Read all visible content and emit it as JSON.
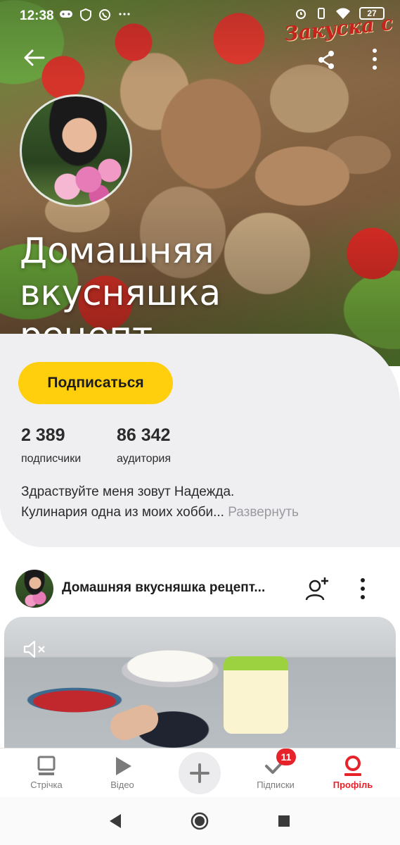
{
  "status_bar": {
    "time": "12:38",
    "battery": "27",
    "left_icons": [
      "gamepad-icon",
      "shield-icon",
      "viber-icon",
      "more-dots-icon"
    ],
    "right_icons": [
      "alarm-icon",
      "vibrate-icon",
      "wifi-icon",
      "battery-icon"
    ]
  },
  "header": {
    "back_icon": "arrow-left-icon",
    "share_icon": "share-icon",
    "more_icon": "kebab-menu-icon",
    "banner_watermark": "Закуска с"
  },
  "channel": {
    "title": "Домашняя вкусняшка рецепт...",
    "subscribe_label": "Подписаться",
    "subscribers_count": "2 389",
    "subscribers_label": "подписчики",
    "audience_count": "86 342",
    "audience_label": "аудитория",
    "about_line1": "Здраствуйте меня зовут Надежда.",
    "about_line2": "Кулинария одна  из моих хобби...",
    "about_expand": "Развернуть"
  },
  "post": {
    "author": "Домашняя вкусняшка рецепт...",
    "follow_icon": "add-user-icon",
    "more_icon": "kebab-menu-icon",
    "mute_icon": "speaker-muted-icon"
  },
  "bottom_nav": {
    "items": [
      {
        "label": "Стрічка",
        "icon": "feed-icon"
      },
      {
        "label": "Відео",
        "icon": "play-icon"
      },
      {
        "label": "",
        "icon": "plus-icon"
      },
      {
        "label": "Підписки",
        "icon": "check-icon",
        "badge": "11"
      },
      {
        "label": "Профіль",
        "icon": "profile-icon"
      }
    ]
  },
  "colors": {
    "accent_yellow": "#ffcf0d",
    "active_red": "#e6232a",
    "card_bg": "#efeff2"
  }
}
